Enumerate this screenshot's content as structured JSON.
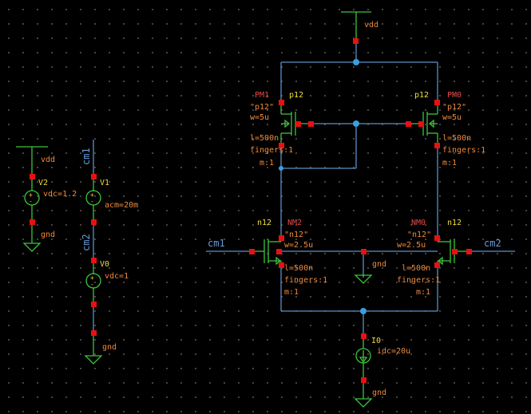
{
  "nets": {
    "vdd": "vdd",
    "gnd": "gnd",
    "cm1": "cm1",
    "cm2": "cm2"
  },
  "sources": {
    "v2": {
      "name": "V2",
      "param": "vdc=1.2"
    },
    "v1": {
      "name": "V1",
      "param": "acm=20m"
    },
    "v0": {
      "name": "V0",
      "param": "vdc=1"
    },
    "i0": {
      "name": "I0",
      "param": "idc=20u"
    }
  },
  "transistors": {
    "pm1": {
      "name": "PM1",
      "model": "p12",
      "cell": "\"p12\"",
      "w": "w=5u",
      "l": "l=500n",
      "fingers": "fingers:1",
      "m": "m:1"
    },
    "pm0": {
      "name": "PM0",
      "model": "p12",
      "cell": "\"p12\"",
      "w": "w=5u",
      "l": "l=500n",
      "fingers": "fingers:1",
      "m": "m:1"
    },
    "nm2": {
      "name": "NM2",
      "model": "n12",
      "cell": "\"n12\"",
      "w": "w=2.5u",
      "l": "l=500n",
      "fingers": "fingers:1",
      "m": "m:1"
    },
    "nm0": {
      "name": "NM0",
      "model": "n12",
      "cell": "\"n12\"",
      "w": "w=2.5u",
      "l": "l=500n",
      "fingers": "fingers:1",
      "m": "m:1"
    }
  },
  "colors": {
    "wire": "#5b8fc7",
    "component": "#3cc43c",
    "pin": "#e81010",
    "junction": "#3a9ee0",
    "instance_label": "#f0dc3c",
    "param_label": "#f08a3a",
    "background": "#000000"
  }
}
